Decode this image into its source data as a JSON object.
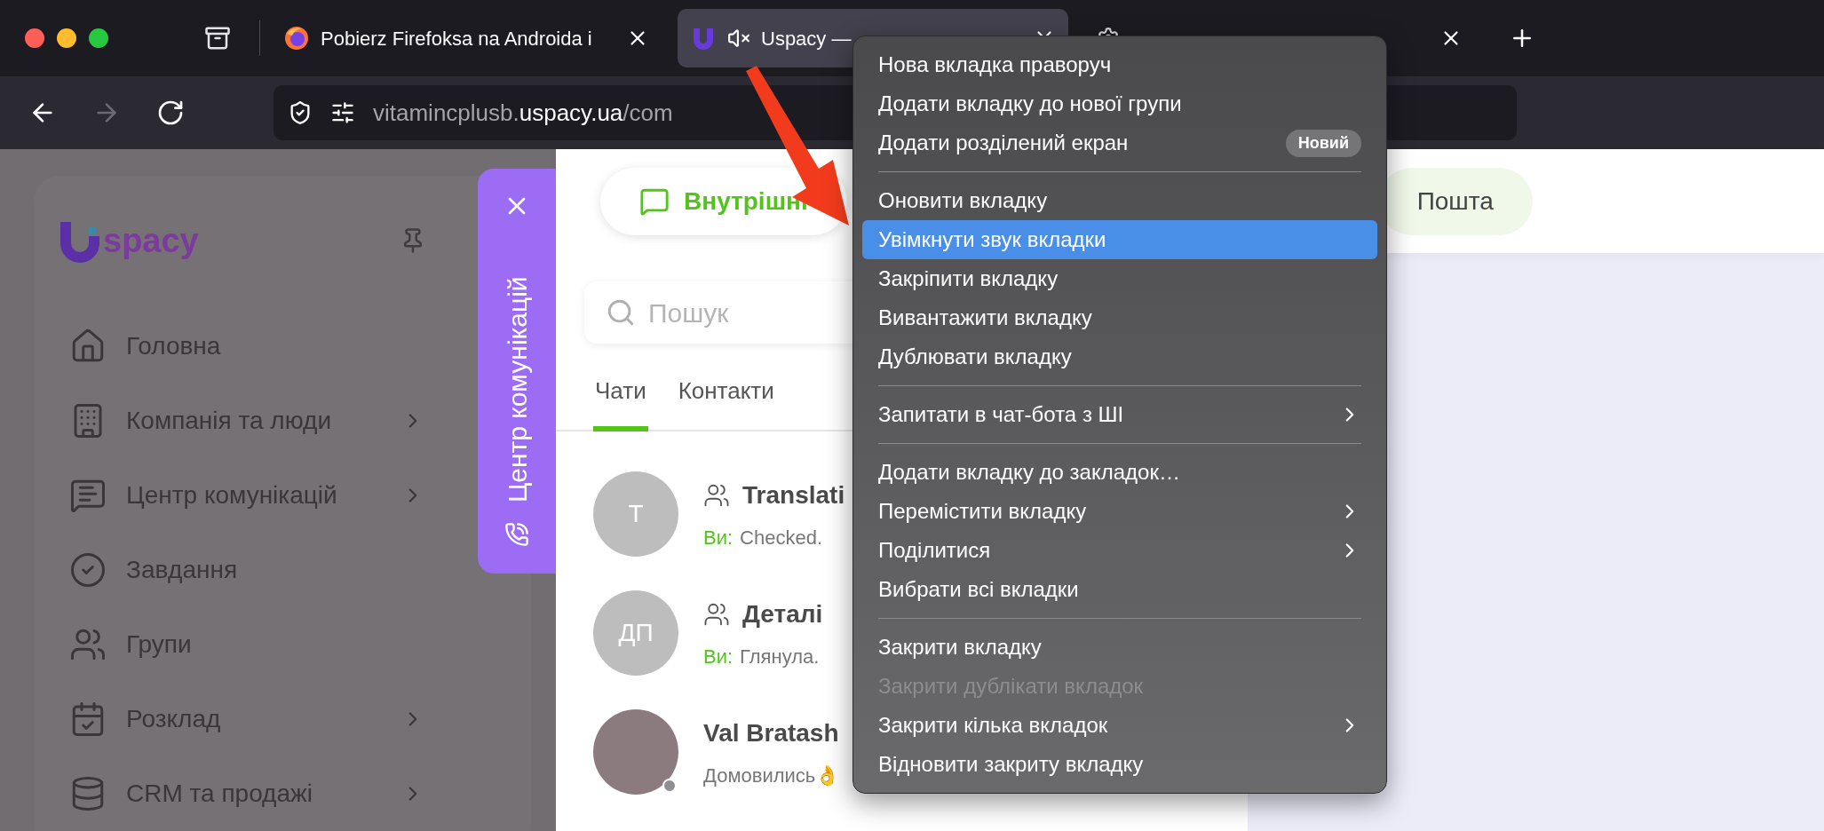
{
  "browser": {
    "tabs": [
      {
        "title": "Pobierz Firefoksa na Androida i",
        "selected": false,
        "muted": false
      },
      {
        "title": "Uspacy —",
        "selected": true,
        "muted": true
      },
      {
        "selected": false,
        "muted": false
      }
    ],
    "navigation": [
      {
        "kind": "back",
        "disabled": false
      },
      {
        "kind": "forward",
        "disabled": true
      },
      {
        "kind": "reload",
        "disabled": false
      }
    ],
    "address": {
      "subdomain": "vitamincplusb.",
      "domain": "uspacy.ua",
      "path": "/com"
    }
  },
  "sidebar": {
    "logo_text": "spacy",
    "items": [
      {
        "label": "Головна",
        "expandable": false
      },
      {
        "label": "Компанія та люди",
        "expandable": true
      },
      {
        "label": "Центр комунікацій",
        "expandable": true
      },
      {
        "label": "Завдання",
        "expandable": false
      },
      {
        "label": "Групи",
        "expandable": false
      },
      {
        "label": "Розклад",
        "expandable": true
      },
      {
        "label": "CRM та продажі",
        "expandable": true
      }
    ]
  },
  "side_panel_tab": {
    "label": "Центр комунікацій"
  },
  "channels": [
    {
      "label": "Внутрішні",
      "selected": true
    },
    {
      "label": "Пошта",
      "selected": false
    }
  ],
  "search": {
    "placeholder": "Пошук"
  },
  "list_tabs": [
    {
      "label": "Чати",
      "selected": true
    },
    {
      "label": "Контакти",
      "selected": false
    }
  ],
  "chats": [
    {
      "kind": "initials",
      "avatar": "Т",
      "group": true,
      "name": "Translati",
      "prefix": "Ви:",
      "preview": "Checked."
    },
    {
      "kind": "initials",
      "avatar": "ДП",
      "group": true,
      "name": "Деталі",
      "prefix": "Ви:",
      "preview": "Глянула."
    },
    {
      "kind": "photo",
      "group": false,
      "name": "Val Bratash",
      "preview": "Домовились👌",
      "online": false
    }
  ],
  "context_menu": {
    "groups": [
      [
        {
          "label": "Нова вкладка праворуч",
          "selected": false,
          "disabled": false,
          "submenu": false
        },
        {
          "label": "Додати вкладку до нової групи",
          "selected": false,
          "disabled": false,
          "submenu": false
        },
        {
          "label": "Додати розділений екран",
          "badge": "Новий",
          "selected": false,
          "disabled": false,
          "submenu": false
        }
      ],
      [
        {
          "label": "Оновити вкладку",
          "selected": false,
          "disabled": false,
          "submenu": false
        },
        {
          "label": "Увімкнути звук вкладки",
          "selected": true,
          "disabled": false,
          "submenu": false
        },
        {
          "label": "Закріпити вкладку",
          "selected": false,
          "disabled": false,
          "submenu": false
        },
        {
          "label": "Вивантажити вкладку",
          "selected": false,
          "disabled": false,
          "submenu": false
        },
        {
          "label": "Дублювати вкладку",
          "selected": false,
          "disabled": false,
          "submenu": false
        }
      ],
      [
        {
          "label": "Запитати в чат-бота з ШІ",
          "selected": false,
          "disabled": false,
          "submenu": true
        }
      ],
      [
        {
          "label": "Додати вкладку до закладок…",
          "selected": false,
          "disabled": false,
          "submenu": false
        },
        {
          "label": "Перемістити вкладку",
          "selected": false,
          "disabled": false,
          "submenu": true
        },
        {
          "label": "Поділитися",
          "selected": false,
          "disabled": false,
          "submenu": true
        },
        {
          "label": "Вибрати всі вкладки",
          "selected": false,
          "disabled": false,
          "submenu": false
        }
      ],
      [
        {
          "label": "Закрити вкладку",
          "selected": false,
          "disabled": false,
          "submenu": false
        },
        {
          "label": "Закрити дублікати вкладок",
          "selected": false,
          "disabled": true,
          "submenu": false
        },
        {
          "label": "Закрити кілька вкладок",
          "selected": false,
          "disabled": false,
          "submenu": true
        },
        {
          "label": "Відновити закриту вкладку",
          "selected": false,
          "disabled": false,
          "submenu": false
        }
      ]
    ]
  }
}
